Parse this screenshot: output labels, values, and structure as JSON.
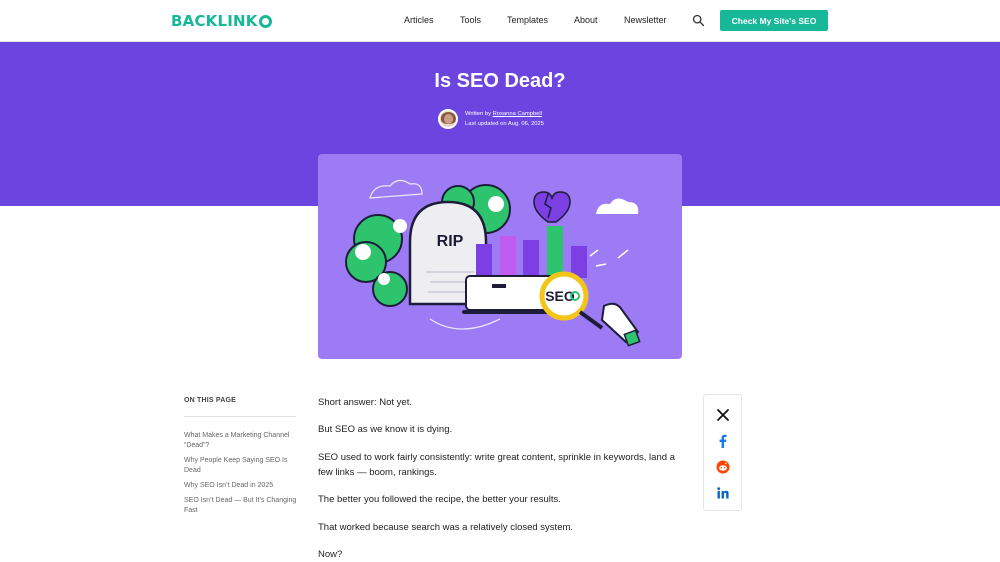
{
  "header": {
    "logo_text": "BACKLINK",
    "nav": [
      "Articles",
      "Tools",
      "Templates",
      "About",
      "Newsletter"
    ],
    "cta_label": "Check My Site's SEO",
    "icons": [
      "search-icon"
    ]
  },
  "hero": {
    "title": "Is SEO Dead?",
    "written_by_label": "Written by",
    "author_name": "Rosanna Campbell",
    "updated": "Last updated on Aug. 06, 2025"
  },
  "feature_image": {
    "rip_text": "RIP",
    "seo_text": "SEO"
  },
  "toc": {
    "title": "ON THIS PAGE",
    "items": [
      "What Makes a Marketing Channel “Dead”?",
      "Why People Keep Saying SEO Is Dead",
      "Why SEO Isn’t Dead in 2025",
      "SEO Isn’t Dead — But It’s Changing Fast"
    ]
  },
  "article": {
    "paragraphs": [
      "Short answer: Not yet.",
      "But SEO as we know it is dying.",
      "SEO used to work fairly consistently: write great content, sprinkle in keywords, land a few links — boom, rankings.",
      "The better you followed the recipe, the better your results.",
      "That worked because search was a relatively closed system.",
      "Now?"
    ]
  },
  "share": {
    "icons": [
      "x-icon",
      "facebook-icon",
      "reddit-icon",
      "linkedin-icon"
    ]
  },
  "colors": {
    "brand": "#17b897",
    "hero": "#6c45e0",
    "feature_bg": "#9c7bf5"
  }
}
